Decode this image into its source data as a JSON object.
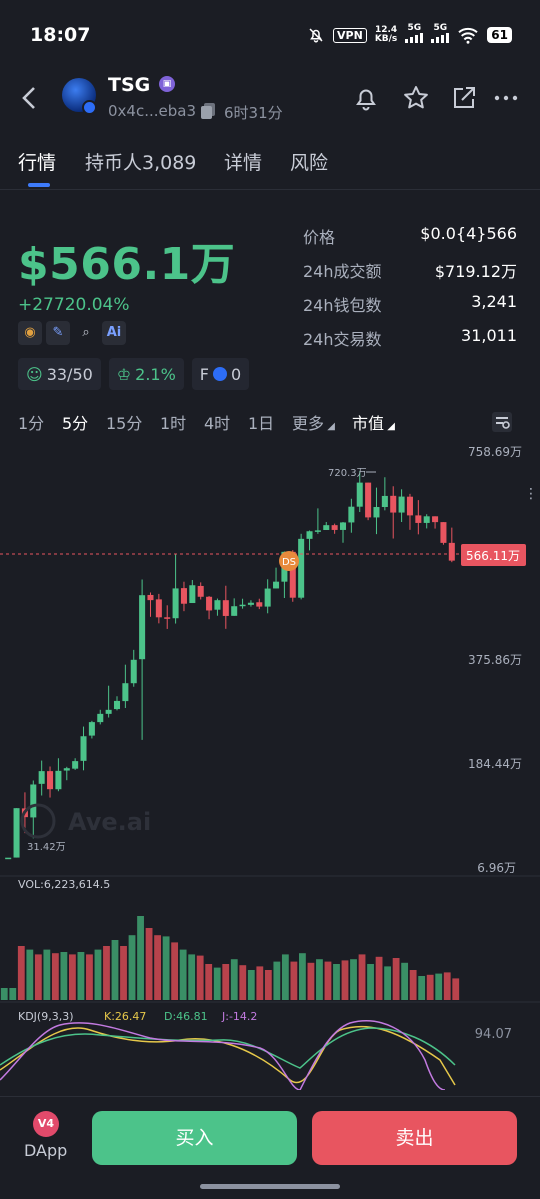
{
  "status": {
    "time": "18:07",
    "vpn": "VPN",
    "speed": "12.4",
    "speed_unit": "KB/s",
    "net1": "5G",
    "net2": "5G",
    "battery": "61"
  },
  "header": {
    "name": "TSG",
    "address": "0x4c...eba3",
    "age": "6时31分"
  },
  "tabs": [
    {
      "label": "行情"
    },
    {
      "label": "持币人3,089"
    },
    {
      "label": "详情"
    },
    {
      "label": "风险"
    }
  ],
  "price": {
    "market_cap": "$566.1万",
    "change": "+27720.04%"
  },
  "stats": [
    {
      "k": "价格",
      "v": "$0.0{4}566"
    },
    {
      "k": "24h成交额",
      "v": "$719.12万"
    },
    {
      "k": "24h钱包数",
      "v": "3,241"
    },
    {
      "k": "24h交易数",
      "v": "31,011"
    }
  ],
  "chips": {
    "holders": "33/50",
    "top": "2.1%",
    "f_label": "F",
    "f_value": "0"
  },
  "intervals": [
    "1分",
    "5分",
    "15分",
    "1时",
    "4时",
    "1日",
    "更多",
    "市值"
  ],
  "chart": {
    "y_labels": [
      "758.69万",
      "375.86万",
      "184.44万",
      "6.96万"
    ],
    "current": "566.11万",
    "high_label": "720.3万",
    "low_label": "31.42万",
    "ds": "DS",
    "watermark": "Ave.ai",
    "vol_label": "VOL:6,223,614.5",
    "kdj_title": "KDJ(9,3,3)",
    "kdj_k": "K:26.47",
    "kdj_d": "D:46.81",
    "kdj_j": "J:-14.2",
    "kdj_top": "94.07"
  },
  "chart_data": {
    "type": "candlestick",
    "unit": "万",
    "y_axis_labels": [
      758.69,
      375.86,
      184.44,
      6.96
    ],
    "current_value": 566.11,
    "marked_high": 720.3,
    "marked_low": 31.42,
    "candles": [
      [
        31.4,
        31.4,
        31.4,
        31.4
      ],
      [
        31.6,
        115.9,
        115.9,
        31.6
      ],
      [
        115.5,
        100.6,
        142.9,
        73.3
      ],
      [
        100.1,
        156.3,
        163.1,
        64.4
      ],
      [
        157.4,
        179.1,
        198.1,
        137.5
      ],
      [
        179.1,
        148.3,
        187.2,
        134.0
      ],
      [
        148.2,
        179.6,
        202.4,
        144.8
      ],
      [
        180.1,
        184.1,
        186.6,
        163.6
      ],
      [
        183.3,
        197.1,
        202.4,
        181.2
      ],
      [
        197.6,
        242.9,
        260.7,
        180.5
      ],
      [
        244.1,
        268.9,
        271.2,
        238.8
      ],
      [
        268.9,
        284.1,
        291.6,
        264.7
      ],
      [
        284.1,
        291.5,
        335.9,
        277.4
      ],
      [
        292.9,
        307.9,
        316.6,
        290.6
      ],
      [
        307.6,
        340.5,
        374.6,
        294.9
      ],
      [
        340.5,
        383.6,
        401.9,
        334.0
      ],
      [
        384.7,
        502.5,
        531.3,
        236.2
      ],
      [
        502.9,
        493.4,
        507.5,
        462.7
      ],
      [
        494.8,
        461.8,
        504.9,
        450.7
      ],
      [
        461.8,
        459.0,
        483.9,
        440.4
      ],
      [
        460.1,
        515.0,
        578.7,
        450.3
      ],
      [
        515.5,
        486.8,
        527.3,
        473.1
      ],
      [
        488.1,
        520.8,
        530.4,
        505.1
      ],
      [
        519.5,
        499.6,
        526.1,
        494.6
      ],
      [
        499.6,
        474.4,
        500.9,
        458.3
      ],
      [
        475.8,
        493.3,
        496.3,
        464.7
      ],
      [
        493.3,
        464.3,
        519.9,
        440.6
      ],
      [
        464.5,
        482.2,
        496.7,
        469.6
      ],
      [
        484.4,
        485.0,
        496.0,
        477.7
      ],
      [
        484.7,
        488.6,
        493.2,
        481.5
      ],
      [
        489.5,
        481.5,
        496.0,
        476.9
      ],
      [
        481.5,
        514.7,
        531.8,
        469.2
      ],
      [
        514.9,
        527.4,
        553.2,
        515.1
      ],
      [
        527.4,
        582.3,
        583.0,
        497.3
      ],
      [
        582.3,
        497.9,
        585.6,
        490.4
      ],
      [
        497.9,
        606.2,
        615.5,
        494.8
      ],
      [
        606.2,
        620.2,
        621.6,
        584.9
      ],
      [
        620.2,
        621.8,
        662.3,
        615.4
      ],
      [
        622.5,
        631.4,
        637.2,
        623.1
      ],
      [
        631.4,
        622.6,
        634.2,
        615.5
      ],
      [
        622.6,
        636.4,
        637.2,
        599.1
      ],
      [
        636.4,
        665.4,
        680.0,
        617.5
      ],
      [
        665.4,
        709.7,
        730.8,
        655.6
      ],
      [
        709.7,
        645.7,
        709.7,
        640.6
      ],
      [
        645.6,
        664.8,
        700.5,
        614.9
      ],
      [
        664.8,
        685.2,
        719.6,
        658.7
      ],
      [
        685.4,
        654.6,
        703.0,
        606.8
      ],
      [
        654.6,
        684.0,
        697.4,
        637.2
      ],
      [
        683.8,
        649.4,
        689.0,
        622.8
      ],
      [
        649.4,
        635.5,
        677.5,
        614.5
      ],
      [
        635.5,
        647.7,
        651.5,
        625.4
      ],
      [
        647.7,
        637.0,
        645.0,
        625.1
      ],
      [
        637.0,
        598.8,
        627.5,
        595.4
      ],
      [
        598.8,
        566.1,
        626.9,
        563.3
      ]
    ],
    "volume": [
      [
        0.1,
        1
      ],
      [
        0.1,
        1
      ],
      [
        0.45,
        0
      ],
      [
        0.42,
        1
      ],
      [
        0.38,
        0
      ],
      [
        0.42,
        1
      ],
      [
        0.39,
        0
      ],
      [
        0.4,
        1
      ],
      [
        0.38,
        0
      ],
      [
        0.4,
        1
      ],
      [
        0.38,
        0
      ],
      [
        0.42,
        1
      ],
      [
        0.45,
        0
      ],
      [
        0.5,
        1
      ],
      [
        0.45,
        0
      ],
      [
        0.54,
        1
      ],
      [
        0.7,
        1
      ],
      [
        0.6,
        0
      ],
      [
        0.54,
        0
      ],
      [
        0.53,
        1
      ],
      [
        0.48,
        0
      ],
      [
        0.42,
        1
      ],
      [
        0.38,
        1
      ],
      [
        0.37,
        0
      ],
      [
        0.3,
        0
      ],
      [
        0.27,
        1
      ],
      [
        0.3,
        0
      ],
      [
        0.34,
        1
      ],
      [
        0.29,
        0
      ],
      [
        0.25,
        1
      ],
      [
        0.28,
        0
      ],
      [
        0.25,
        0
      ],
      [
        0.32,
        1
      ],
      [
        0.38,
        1
      ],
      [
        0.32,
        0
      ],
      [
        0.39,
        1
      ],
      [
        0.31,
        0
      ],
      [
        0.34,
        1
      ],
      [
        0.32,
        0
      ],
      [
        0.3,
        1
      ],
      [
        0.33,
        0
      ],
      [
        0.34,
        1
      ],
      [
        0.38,
        0
      ],
      [
        0.3,
        1
      ],
      [
        0.36,
        0
      ],
      [
        0.28,
        1
      ],
      [
        0.35,
        0
      ],
      [
        0.31,
        1
      ],
      [
        0.25,
        0
      ],
      [
        0.2,
        1
      ],
      [
        0.21,
        0
      ],
      [
        0.22,
        1
      ],
      [
        0.23,
        0
      ],
      [
        0.18,
        0
      ]
    ],
    "vol_total": 6223614.5,
    "kdj": {
      "K": 26.47,
      "D": 46.81,
      "J": -14.2,
      "top": 94.07
    }
  }
}
